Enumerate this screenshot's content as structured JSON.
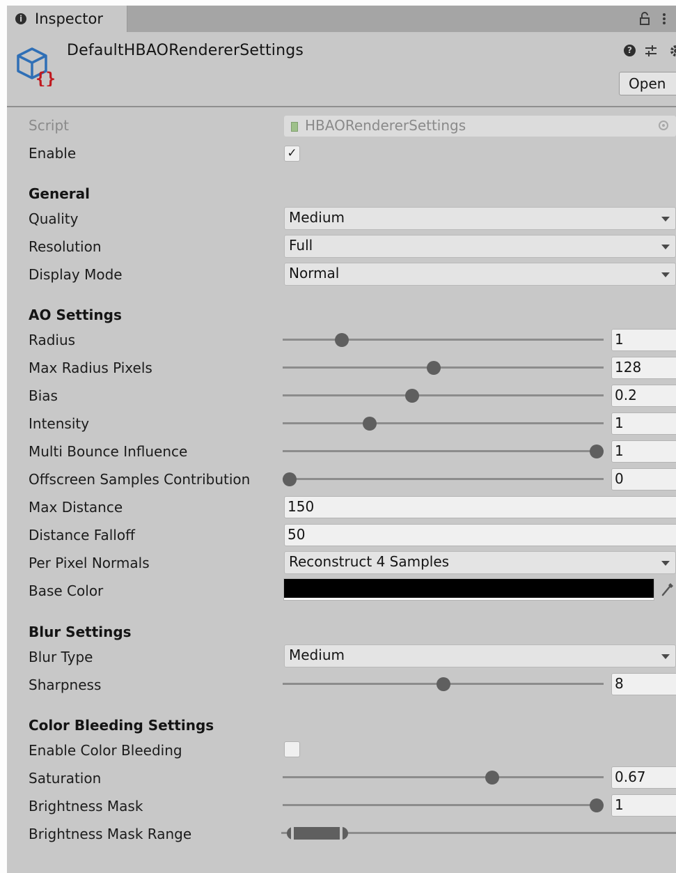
{
  "tab": {
    "label": "Inspector",
    "info_glyph": "i"
  },
  "asset": {
    "name": "DefaultHBAORendererSettings",
    "open_label": "Open"
  },
  "rows": {
    "script": {
      "label": "Script",
      "value": "HBAORendererSettings"
    },
    "enable": {
      "label": "Enable",
      "checked": true,
      "check_glyph": "✓"
    }
  },
  "general": {
    "header": "General",
    "quality": {
      "label": "Quality",
      "value": "Medium"
    },
    "resolution": {
      "label": "Resolution",
      "value": "Full"
    },
    "display_mode": {
      "label": "Display Mode",
      "value": "Normal"
    }
  },
  "ao": {
    "header": "AO Settings",
    "radius": {
      "label": "Radius",
      "value": "1",
      "fraction": 0.17
    },
    "max_radius_pixels": {
      "label": "Max Radius Pixels",
      "value": "128",
      "fraction": 0.47
    },
    "bias": {
      "label": "Bias",
      "value": "0.2",
      "fraction": 0.4
    },
    "intensity": {
      "label": "Intensity",
      "value": "1",
      "fraction": 0.26
    },
    "multi_bounce": {
      "label": "Multi Bounce Influence",
      "value": "1",
      "fraction": 1.0
    },
    "offscreen": {
      "label": "Offscreen Samples Contribution",
      "value": "0",
      "fraction": 0.0
    },
    "max_distance": {
      "label": "Max Distance",
      "value": "150"
    },
    "distance_falloff": {
      "label": "Distance Falloff",
      "value": "50"
    },
    "per_pixel_normals": {
      "label": "Per Pixel Normals",
      "value": "Reconstruct 4 Samples"
    },
    "base_color": {
      "label": "Base Color",
      "color": "#000000"
    }
  },
  "blur": {
    "header": "Blur Settings",
    "blur_type": {
      "label": "Blur Type",
      "value": "Medium"
    },
    "sharpness": {
      "label": "Sharpness",
      "value": "8",
      "fraction": 0.5
    }
  },
  "color_bleeding": {
    "header": "Color Bleeding Settings",
    "enable": {
      "label": "Enable Color Bleeding",
      "checked": false
    },
    "saturation": {
      "label": "Saturation",
      "value": "0.67",
      "fraction": 0.66
    },
    "brightness_mask": {
      "label": "Brightness Mask",
      "value": "1",
      "fraction": 1.0
    },
    "brightness_mask_range": {
      "label": "Brightness Mask Range",
      "min_fraction": 0.0,
      "max_fraction": 0.17
    }
  },
  "colors": {
    "panel_bg": "#c8c8c8",
    "tab_bar": "#a5a5a5",
    "thumb": "#5f5f5f",
    "icon_blue": "#2f6fb6",
    "icon_red": "#c0191f"
  }
}
